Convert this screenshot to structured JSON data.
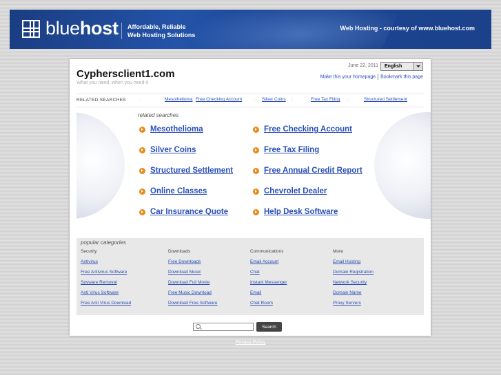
{
  "header": {
    "logo_light": "blue",
    "logo_bold": "host",
    "tagline_line1": "Affordable, Reliable",
    "tagline_line2": "Web Hosting Solutions",
    "courtesy": "Web Hosting - courtesy of www.bluehost.com",
    "brand_color": "#1c4695"
  },
  "site": {
    "title": "Cyphersclient1.com",
    "subtitle": "What you need, when you need it",
    "date": "June 22, 2011",
    "language_selected": "English",
    "make_homepage": "Make this your homepage",
    "bookmark": "Bookmark this page"
  },
  "related_bar": {
    "label": "RELATED SEARCHES",
    "links": [
      "Mesothelioma",
      "Free Checking Account",
      "Silver Coins",
      "Free Tax Filing",
      "Structured Settlement"
    ]
  },
  "related_searches": {
    "heading": "related searches",
    "left": [
      "Mesothelioma",
      "Silver Coins",
      "Structured Settlement",
      "Online Classes",
      "Car Insurance Quote"
    ],
    "right": [
      "Free Checking Account",
      "Free Tax Filing",
      "Free Annual Credit Report",
      "Chevrolet Dealer",
      "Help Desk Software"
    ]
  },
  "popular": {
    "heading": "popular categories",
    "columns": [
      {
        "title": "Security",
        "links": [
          "Antivirus",
          "Free Antivirus Software",
          "Spyware Removal",
          "Anti Virus Software",
          "Free Anti Virus Download"
        ]
      },
      {
        "title": "Downloads",
        "links": [
          "Free Downloads",
          "Download Music",
          "Download Full Movie",
          "Free Music Download",
          "Download Free Software"
        ]
      },
      {
        "title": "Communications",
        "links": [
          "Email Account",
          "Chat",
          "Instant Messenger",
          "Email",
          "Chat Room"
        ]
      },
      {
        "title": "More",
        "links": [
          "Email Hosting",
          "Domain Registration",
          "Network Security",
          "Domain Name",
          "Proxy Servers"
        ]
      }
    ]
  },
  "search": {
    "button": "Search",
    "value": ""
  },
  "footer": {
    "privacy": "Privacy Policy"
  }
}
